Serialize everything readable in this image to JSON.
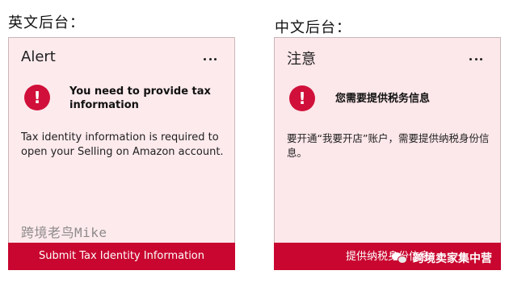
{
  "headings": {
    "english_backend": "英文后台：",
    "chinese_backend": "中文后台："
  },
  "colors": {
    "card_background": "#fdeaed",
    "alert_red": "#d0103a",
    "button_red": "#c8062f"
  },
  "english_card": {
    "title": "Alert",
    "alert_icon_glyph": "!",
    "alert_heading": "You need to provide tax information",
    "body": "Tax identity information is required to open your Selling on Amazon account.",
    "watermark": "跨境老鸟Mike",
    "button_label": "Submit Tax Identity Information"
  },
  "chinese_card": {
    "title": "注意",
    "alert_icon_glyph": "!",
    "alert_heading": "您需要提供税务信息",
    "body": "要开通“我要开店”账户，需要提供纳税身份信息。",
    "button_label": "提供纳税身份信息",
    "wechat_overlay": "跨境卖家集中营"
  },
  "icons": {
    "more": "more-options-icon",
    "alert": "alert-icon",
    "wechat": "wechat-icon"
  }
}
